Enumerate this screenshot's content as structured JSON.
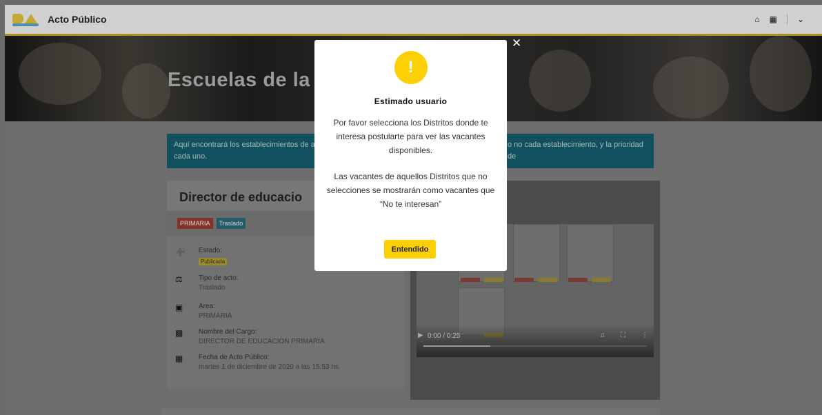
{
  "header": {
    "app_title": "Acto Público",
    "icons": [
      "home-icon",
      "grid-icon",
      "chevron-down-icon"
    ]
  },
  "hero": {
    "title": "Escuelas de la"
  },
  "banner": {
    "text_left": "Aquí encontrará los establecimientos de acu",
    "text_left_2": "cada uno.",
    "text_right": "o no cada establecimiento, y la prioridad de"
  },
  "card": {
    "title": "Director de educacio",
    "badges": [
      "PRIMARIA",
      "Traslado"
    ],
    "fields": [
      {
        "icon": "plus-circle-icon",
        "label": "Estado:",
        "value": "Publicada"
      },
      {
        "icon": "building-icon",
        "label": "Tipo de acto:",
        "value": "Traslado"
      },
      {
        "icon": "screen-icon",
        "label": "Area:",
        "value": "PRIMARIA"
      },
      {
        "icon": "briefcase-icon",
        "label": "Nombre del Cargo:",
        "value": "DIRECTOR DE EDUCACION PRIMARIA"
      },
      {
        "icon": "calendar-icon",
        "label": "Fecha de Acto Público:",
        "value": "martes 1 de diciembre de 2020 a las 15:53 hs."
      }
    ]
  },
  "video": {
    "time": "0:00 / 0:25",
    "progress": 0.3
  },
  "modal": {
    "icon": "!",
    "title": "Estimado usuario",
    "message_1": "Por favor selecciona los Distritos donde te interesa postularte para ver las vacantes disponibles.",
    "message_2": "Las vacantes de aquellos Distritos que no selecciones se mostrarán como vacantes que “No te interesan”",
    "button_label": "Entendido",
    "close": "✕"
  },
  "colors": {
    "accent": "#fdd006",
    "warning": "#fdd006",
    "info": "#11515f"
  }
}
